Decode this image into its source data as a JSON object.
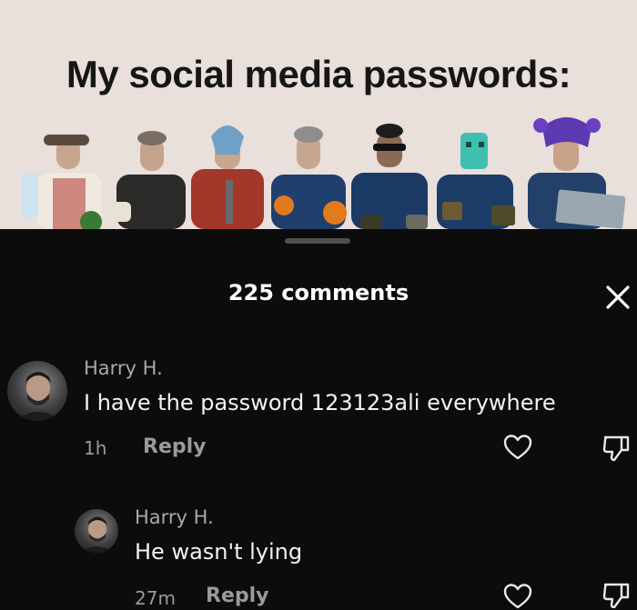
{
  "meme": {
    "title": "My social media passwords:"
  },
  "comments_panel": {
    "count_label": "225 comments",
    "comments": [
      {
        "username": "Harry H.",
        "text": "I have the password 123123ali everywhere",
        "time": "1h",
        "reply_label": "Reply"
      }
    ],
    "replies": [
      {
        "username": "Harry H.",
        "text": "He wasn't lying",
        "time": "27m",
        "reply_label": "Reply"
      }
    ]
  },
  "icons": [
    "close-icon",
    "heart-icon",
    "dislike-icon"
  ],
  "colors": {
    "meme_background": "#e9dfdb",
    "panel_background": "#0c0c0c",
    "text_primary": "#f2f2f2",
    "text_secondary": "#9a9a9a"
  }
}
